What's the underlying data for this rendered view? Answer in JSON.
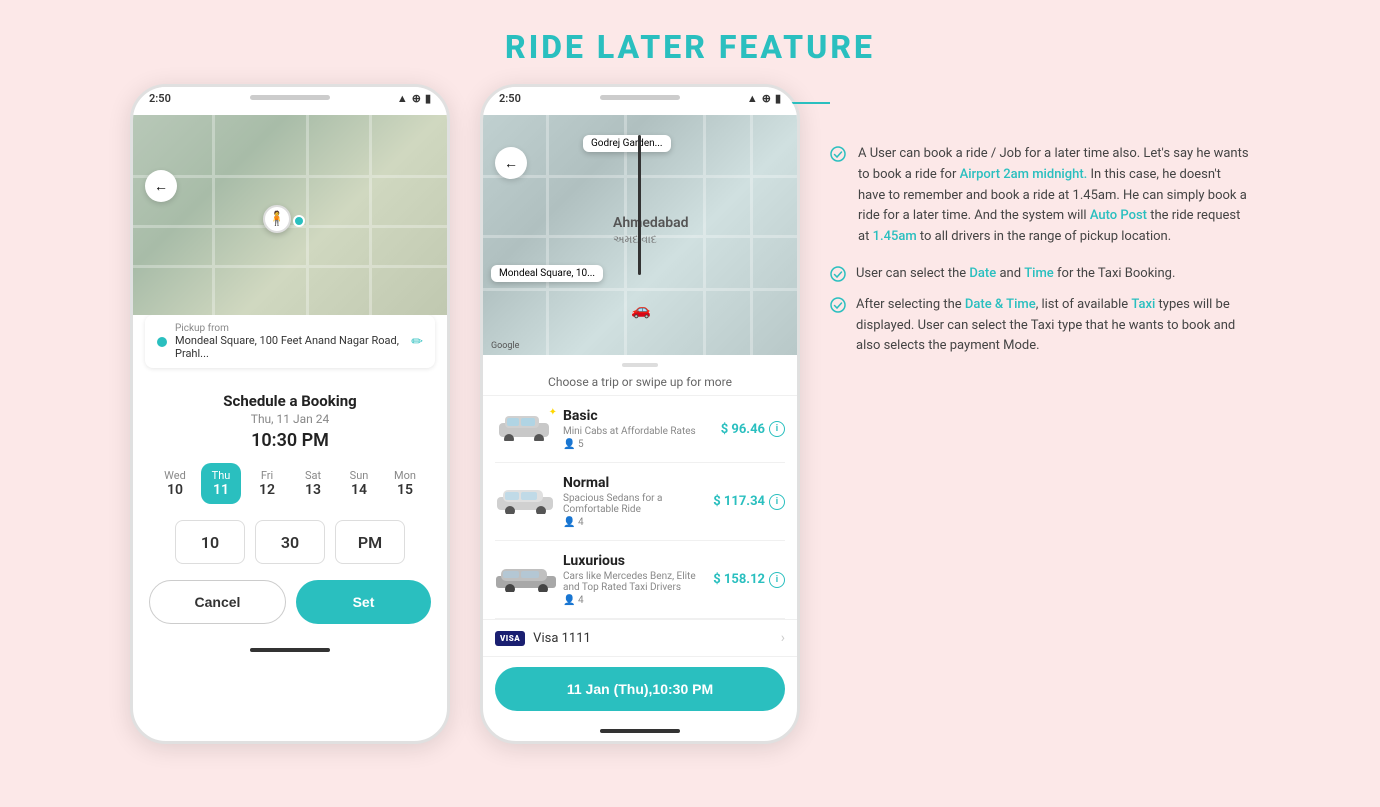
{
  "page": {
    "title": "RIDE LATER FEATURE",
    "background": "#fce8e8"
  },
  "phone1": {
    "status_time": "2:50",
    "map": {
      "pickup_label": "Pickup from",
      "pickup_address": "Mondeal Square, 100 Feet Anand Nagar Road, Prahl..."
    },
    "schedule": {
      "title": "Schedule a Booking",
      "date": "Thu, 11 Jan 24",
      "time": "10:30 PM",
      "days": [
        {
          "name": "Wed",
          "num": "10",
          "selected": false
        },
        {
          "name": "Thu",
          "num": "11",
          "selected": true
        },
        {
          "name": "Fri",
          "num": "12",
          "selected": false
        },
        {
          "name": "Sat",
          "num": "13",
          "selected": false
        },
        {
          "name": "Sun",
          "num": "14",
          "selected": false
        },
        {
          "name": "Mon",
          "num": "15",
          "selected": false
        }
      ],
      "hour": "10",
      "minute": "30",
      "period": "PM",
      "cancel_label": "Cancel",
      "set_label": "Set"
    }
  },
  "phone2": {
    "status_time": "2:50",
    "map": {
      "city": "Ahmedabad",
      "city_gujarati": "અમદાવાદ",
      "pickup_label": "Mondeal Square, 10...",
      "pickup_city": "Godrej Garden..."
    },
    "choose_label": "Choose a trip or swipe up for more",
    "rides": [
      {
        "name": "Basic",
        "desc": "Mini Cabs at Affordable Rates",
        "capacity": "5",
        "price": "$ 96.46",
        "type": "basic"
      },
      {
        "name": "Normal",
        "desc": "Spacious Sedans for a Comfortable Ride",
        "capacity": "4",
        "price": "$ 117.34",
        "type": "normal"
      },
      {
        "name": "Luxurious",
        "desc": "Cars like Mercedes Benz, Elite and Top Rated Taxi Drivers",
        "capacity": "4",
        "price": "$ 158.12",
        "type": "lux"
      }
    ],
    "payment": {
      "brand": "VISA",
      "label": "Visa 1111"
    },
    "book_button": "11 Jan (Thu),10:30 PM"
  },
  "description": {
    "main_text": "A User can book a ride / Job for a later time also. Let's say he wants to book a ride for Airport 2am midnight. In this case, he doesn't have to remember and book a ride at 1.45am. He can simply book a ride for a later time. And the system will Auto Post the ride request at 1.45am to all drivers in the range of pickup location.",
    "sub_points": [
      "User can select the Date and Time for the Taxi Booking.",
      "After selecting the Date & Time, list of available Taxi types will be displayed. User can select the Taxi type that he wants to book and also selects the payment Mode."
    ]
  }
}
